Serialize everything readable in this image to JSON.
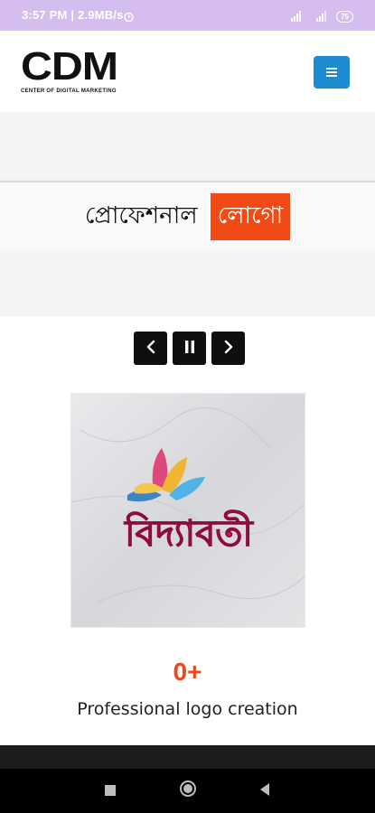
{
  "status_bar": {
    "time": "3:57 PM | 2.9MB/s",
    "alarm_icon": "alarm-icon",
    "signal_icon": "signal-icon",
    "battery_icon": "battery-icon",
    "battery_level": "75"
  },
  "header": {
    "logo_text": "CDM",
    "logo_tagline": "CENTER OF DIGITAL MARKETING",
    "menu_icon": "hamburger-icon"
  },
  "hero": {
    "text": "প্রোফেশনাল",
    "highlight": "লোগো"
  },
  "slider": {
    "prev_icon": "chevron-left-icon",
    "pause_icon": "pause-icon",
    "next_icon": "chevron-right-icon",
    "slide_text": "বিদ্যাবতী"
  },
  "counter": {
    "value": "0+",
    "label": "Professional logo creation"
  },
  "nav_bar": {
    "recents_icon": "square-icon",
    "home_icon": "circle-icon",
    "back_icon": "triangle-back-icon"
  },
  "colors": {
    "status_bar": "#d5bdf0",
    "menu_button": "#1e8ad2",
    "highlight": "#f14a14",
    "counter": "#e84a1d"
  }
}
